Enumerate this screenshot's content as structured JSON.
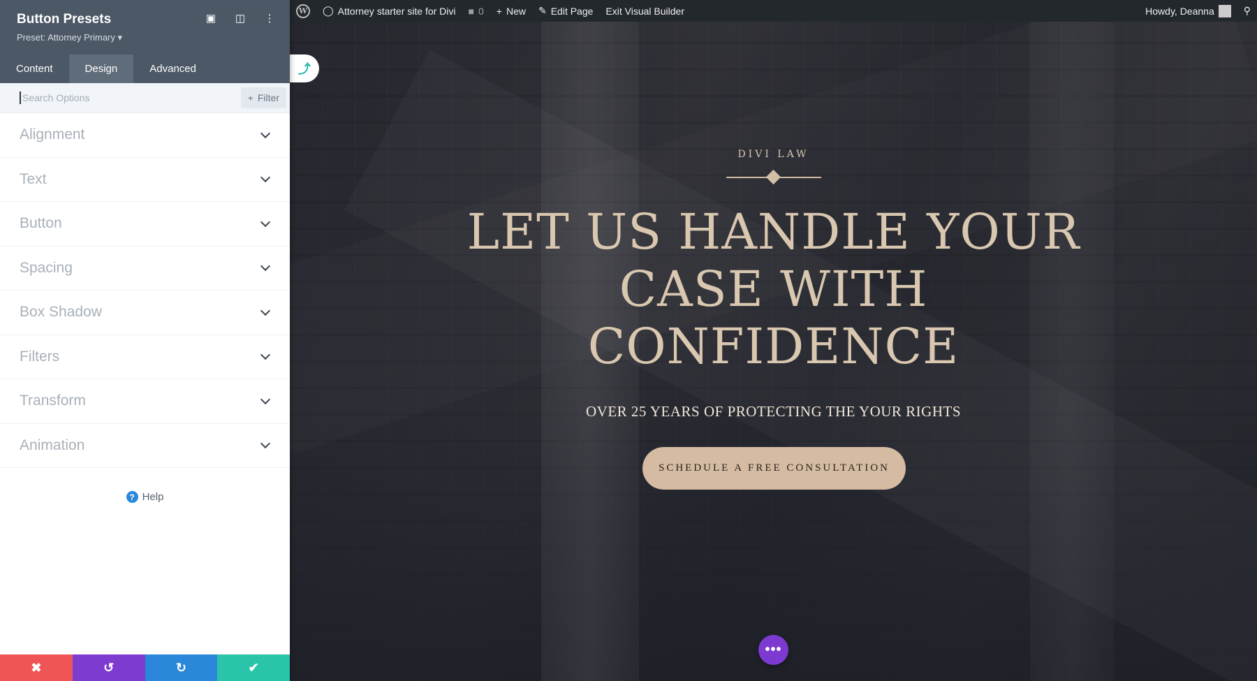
{
  "adminbar": {
    "site_name": "Attorney starter site for Divi",
    "comments_count": "0",
    "new_label": "New",
    "edit_label": "Edit Page",
    "exit_label": "Exit Visual Builder",
    "user_greeting": "Howdy, Deanna"
  },
  "panel": {
    "title": "Button Presets",
    "preset": "Preset: Attorney Primary",
    "tabs": [
      {
        "label": "Content"
      },
      {
        "label": "Design"
      },
      {
        "label": "Advanced"
      }
    ],
    "active_tab": "Design",
    "search_placeholder": "Search Options",
    "filter_label": "Filter",
    "sections": [
      {
        "label": "Alignment"
      },
      {
        "label": "Text"
      },
      {
        "label": "Button"
      },
      {
        "label": "Spacing"
      },
      {
        "label": "Box Shadow"
      },
      {
        "label": "Filters"
      },
      {
        "label": "Transform"
      },
      {
        "label": "Animation"
      }
    ],
    "help_label": "Help"
  },
  "hero": {
    "eyebrow": "DIVI LAW",
    "headline": "LET US HANDLE YOUR CASE WITH CONFIDENCE",
    "subhead": "OVER 25 YEARS OF PROTECTING THE YOUR RIGHTS",
    "cta": "SCHEDULE A FREE CONSULTATION"
  },
  "colors": {
    "panel_header": "#4c5866",
    "cancel": "#ef5555",
    "undo": "#7e3bd0",
    "redo": "#2b87da",
    "save": "#29c4a9",
    "accent_gold": "#d4bba1"
  },
  "icons": [
    "wordpress-icon",
    "dashboard-icon",
    "comment-icon",
    "plus-icon",
    "pencil-icon",
    "search-icon",
    "fullscreen-icon",
    "split-view-icon",
    "more-vertical-icon",
    "close-icon",
    "undo-icon",
    "redo-icon",
    "check-icon",
    "help-icon",
    "dots-icon",
    "toggle-arrow-icon"
  ]
}
